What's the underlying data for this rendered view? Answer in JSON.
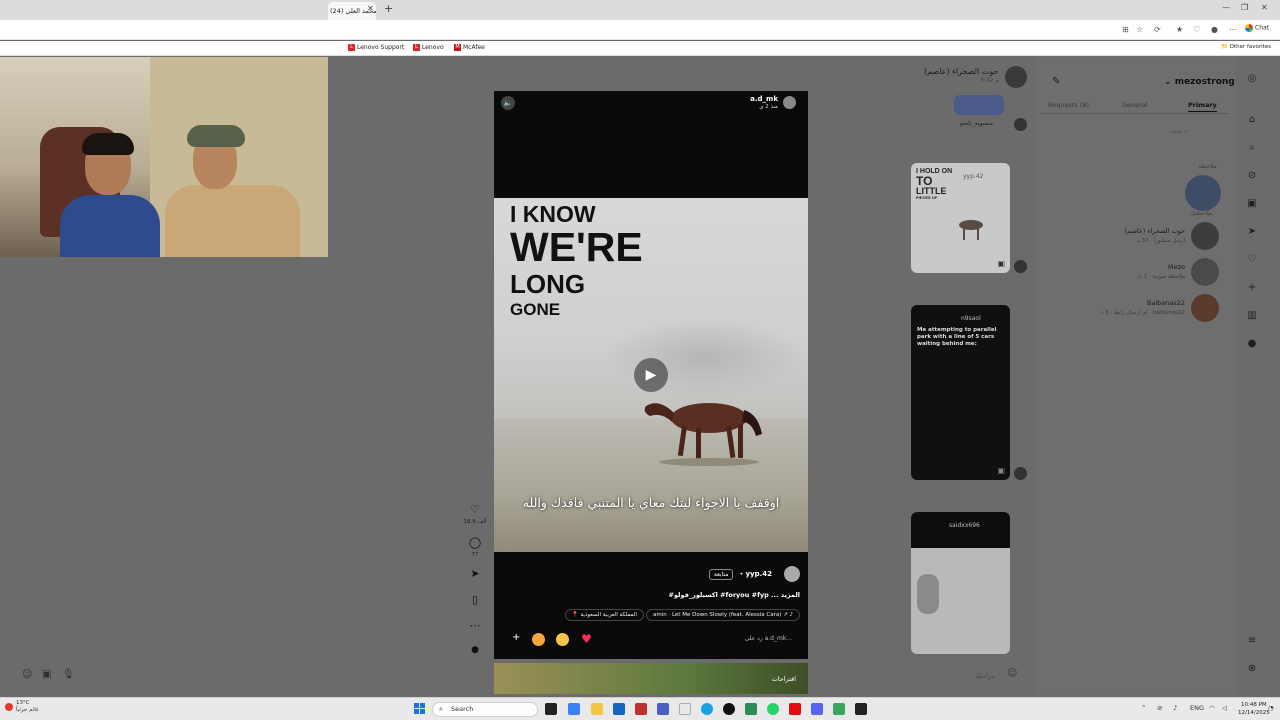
{
  "browser": {
    "tab_title": "محمد العلي (24)",
    "tab_close": "✕",
    "new_tab": "+",
    "chat_label": "Chat",
    "bookmarks": [
      {
        "label": "Lenovo Support",
        "logo": "L"
      },
      {
        "label": "Lenovo",
        "logo": "L"
      },
      {
        "label": "McAfee",
        "logo": "M"
      }
    ],
    "other_favorites": "Other favorites"
  },
  "reel": {
    "username": "a.d_mk",
    "time_ago": "منذ 2 ي",
    "mute_icon": "🔈",
    "overlay_lines": [
      "I KNOW",
      "WE'RE",
      "LONG",
      "GONE"
    ],
    "subtitle": "اوقفف يا الاجواء ليتك معاي يا المتنبي فاقدك والله",
    "play_icon": "▶",
    "poster_handle": "yyp.42",
    "follow_label": "متابعة",
    "caption": "#اكسبلور_فولو #foryou #fyp ... المزيد",
    "music": "amin · Let Me Down Slowly (feat. Alessia Cara)",
    "music_arrow": "↗ ♪",
    "location": "المملكة العربية السعودية",
    "location_icon": "📍",
    "reply_plus": "+",
    "reply_placeholder": "رد على a.d_mk...",
    "suggestions_label": "اقتراحات",
    "likes": "18.9 ألف",
    "comments": "77",
    "icons": {
      "like": "heart-icon",
      "comment": "comment-icon",
      "share": "send-icon",
      "save": "bookmark-icon",
      "more": "more-icon"
    },
    "colors": {
      "emoji1": "#f4a63a",
      "emoji2": "#f7c447",
      "heart": "#ff2d55"
    }
  },
  "feed": {
    "header_name": "حوت الصحراء (عاصم)",
    "header_sub": "3:42 م",
    "card1_user": "منسوبة_تامنو",
    "card2_text": [
      "I HOLD ON",
      "TO",
      "LITTLE",
      "PIECES OF"
    ],
    "card2_user": "yyp.42",
    "card3_user": "n9saol",
    "card3_text": "Me attempting to parallel park with a line of 5 cars waiting behind me:",
    "card4_user": "saidxx696"
  },
  "dm": {
    "username": "mezostrong",
    "chevron": "⌄",
    "tabs": [
      "Requests (8)",
      "General",
      "Primary"
    ],
    "search_placeholder": "بحث",
    "note_label": "ملاحظة",
    "note_sub": "ملاحظتك",
    "rows": [
      {
        "name": "حوت الصحراء (عاصم)",
        "sub": "أرسل منشوراً · 37 د"
      },
      {
        "name": "Mezo",
        "sub": "ملاحظة صوتية · 1 ث"
      },
      {
        "name": "Balbanas22",
        "sub": "تم إرسال رابط · 3 د · balbanas22"
      }
    ],
    "message_placeholder": "مراسلة..."
  },
  "taskbar": {
    "weather_temp": "13°C",
    "weather_desc": "غائم جزئياً",
    "search_label": "Search",
    "lang": "ENG",
    "time": "10:48 PM",
    "date": "12/14/2025"
  }
}
